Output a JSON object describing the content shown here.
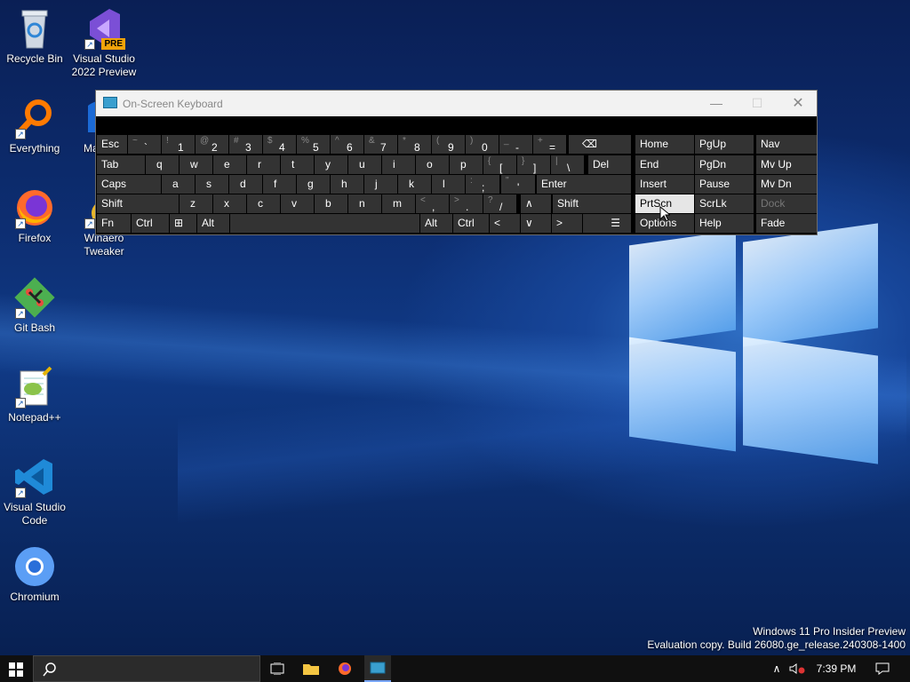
{
  "desktop": {
    "icons": [
      {
        "label": "Recycle Bin",
        "icon": "recycle-bin-icon"
      },
      {
        "label": "Visual Studio 2022 Preview",
        "icon": "visual-studio-preview-icon",
        "badge": "PRE"
      },
      {
        "label": "Everything",
        "icon": "everything-search-icon"
      },
      {
        "label": "Malw",
        "icon": "malwarebytes-icon"
      },
      {
        "label": "Firefox",
        "icon": "firefox-icon"
      },
      {
        "label": "Winaero Tweaker",
        "icon": "winaero-tweaker-icon"
      },
      {
        "label": "Git Bash",
        "icon": "git-bash-icon"
      },
      {
        "label": "Notepad++",
        "icon": "notepadplusplus-icon"
      },
      {
        "label": "Visual Studio Code",
        "icon": "vscode-icon"
      },
      {
        "label": "Chromium",
        "icon": "chromium-icon"
      }
    ]
  },
  "osk": {
    "title": "On-Screen Keyboard",
    "keys": {
      "esc": "Esc",
      "tab": "Tab",
      "caps": "Caps",
      "shift": "Shift",
      "fn": "Fn",
      "ctrl": "Ctrl",
      "alt": "Alt",
      "altgr": "Alt",
      "rctrl": "Ctrl",
      "del": "Del",
      "enter": "Enter",
      "rshift": "Shift",
      "home": "Home",
      "pgup": "PgUp",
      "nav": "Nav",
      "end": "End",
      "pgdn": "PgDn",
      "mvup": "Mv Up",
      "insert": "Insert",
      "pause": "Pause",
      "mvdn": "Mv Dn",
      "prtscn": "PrtScn",
      "scrlk": "ScrLk",
      "dock": "Dock",
      "options": "Options",
      "help": "Help",
      "fade": "Fade",
      "backspace_glyph": "⌫",
      "up_glyph": "∧",
      "down_glyph": "∨",
      "left_glyph": "<",
      "right_glyph": ">",
      "menu_glyph": "☰",
      "win_glyph": "⊞"
    },
    "number_row": [
      [
        "~",
        "`"
      ],
      [
        "!",
        "1"
      ],
      [
        "@",
        "2"
      ],
      [
        "#",
        "3"
      ],
      [
        "$",
        "4"
      ],
      [
        "%",
        "5"
      ],
      [
        "^",
        "6"
      ],
      [
        "&",
        "7"
      ],
      [
        "*",
        "8"
      ],
      [
        "(",
        "9"
      ],
      [
        ")",
        "0"
      ],
      [
        "_",
        "-"
      ],
      [
        "+",
        "="
      ]
    ],
    "q_row": [
      "q",
      "w",
      "e",
      "r",
      "t",
      "y",
      "u",
      "i",
      "o",
      "p"
    ],
    "q_row_sym": [
      [
        "{",
        "["
      ],
      [
        "}",
        "]"
      ],
      [
        "|",
        "\\"
      ]
    ],
    "a_row": [
      "a",
      "s",
      "d",
      "f",
      "g",
      "h",
      "j",
      "k",
      "l"
    ],
    "a_row_sym": [
      [
        ":",
        ";"
      ],
      [
        "\"",
        "'"
      ]
    ],
    "z_row": [
      "z",
      "x",
      "c",
      "v",
      "b",
      "n",
      "m"
    ],
    "z_row_sym": [
      [
        "<",
        ","
      ],
      [
        ">",
        "."
      ],
      [
        "?",
        "/"
      ]
    ]
  },
  "watermark": {
    "line1": "Windows 11 Pro Insider Preview",
    "line2": "Evaluation copy. Build 26080.ge_release.240308-1400"
  },
  "taskbar": {
    "time": "7:39 PM",
    "start_icon": "windows-start-icon",
    "search_icon": "search-icon"
  },
  "colors": {
    "taskbar": "#101010",
    "key": "#333333",
    "key_selected": "#e6e6e6",
    "osk_title": "#f2f2f2"
  }
}
